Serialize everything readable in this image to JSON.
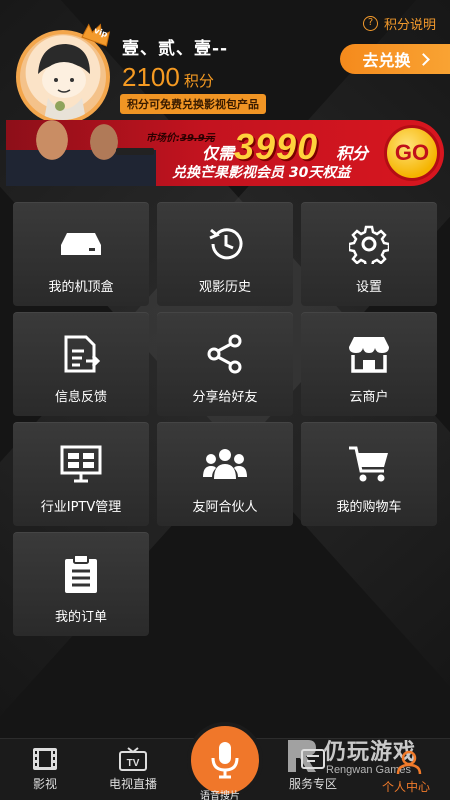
{
  "header": {
    "points_help": "积分说明",
    "user_name": "壹、贰、壹--",
    "points_value": "2100",
    "points_unit": "积分",
    "points_note": "积分可免费兑换影视包产品",
    "exchange_button": "去兑换",
    "vip_badge": "vip"
  },
  "banner": {
    "market_label": "市场价:",
    "market_price": "39.9元",
    "only_text": "仅需",
    "points_required": "3990",
    "points_unit": "积分",
    "description": "兑换芒果影视会员 30天权益",
    "go_label": "GO"
  },
  "grid": {
    "items": [
      {
        "label": "我的机顶盒",
        "icon": "set-top-box-icon"
      },
      {
        "label": "观影历史",
        "icon": "history-icon"
      },
      {
        "label": "设置",
        "icon": "gear-icon"
      },
      {
        "label": "信息反馈",
        "icon": "feedback-icon"
      },
      {
        "label": "分享给好友",
        "icon": "share-icon"
      },
      {
        "label": "云商户",
        "icon": "store-icon"
      },
      {
        "label": "行业IPTV管理",
        "icon": "iptv-management-icon"
      },
      {
        "label": "友阿合伙人",
        "icon": "partners-icon"
      },
      {
        "label": "我的购物车",
        "icon": "cart-icon"
      },
      {
        "label": "我的订单",
        "icon": "order-icon"
      }
    ]
  },
  "bottom_nav": {
    "items": [
      {
        "label": "影视",
        "icon": "film-icon"
      },
      {
        "label": "电视直播",
        "icon": "tv-icon"
      },
      {
        "label": "语音搜片",
        "icon": "microphone-icon"
      },
      {
        "label": "服务专区",
        "icon": "service-icon"
      },
      {
        "label": "个人中心",
        "icon": "person-icon"
      }
    ],
    "tv_icon_text": "TV",
    "active_color": "#f07a2a"
  },
  "watermark": {
    "cn": "仍玩游戏",
    "en": "Rengwan Games"
  },
  "colors": {
    "accent": "#f59a22",
    "background": "#151515",
    "tile": "#333333"
  }
}
